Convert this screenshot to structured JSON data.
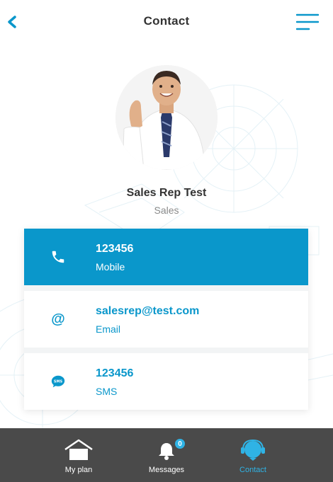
{
  "header": {
    "title": "Contact",
    "back_icon": "chevron-left-icon",
    "menu_icon": "hamburger-menu-icon"
  },
  "profile": {
    "name": "Sales Rep Test",
    "role": "Sales"
  },
  "contacts": [
    {
      "value": "123456",
      "label": "Mobile",
      "icon": "phone-icon",
      "active": true
    },
    {
      "value": "salesrep@test.com",
      "label": "Email",
      "icon": "at-icon",
      "active": false
    },
    {
      "value": "123456",
      "label": "SMS",
      "icon": "sms-icon",
      "active": false
    }
  ],
  "nav": {
    "items": [
      {
        "label": "My plan",
        "icon": "house-icon"
      },
      {
        "label": "Messages",
        "icon": "bell-icon",
        "badge": "0"
      },
      {
        "label": "Contact",
        "icon": "headset-icon",
        "active": true
      }
    ]
  },
  "colors": {
    "accent": "#0a97cb",
    "nav_background": "#4a4a4a",
    "nav_active": "#2fb3e5",
    "title_text": "#333333",
    "muted_text": "#8a8a8a"
  }
}
